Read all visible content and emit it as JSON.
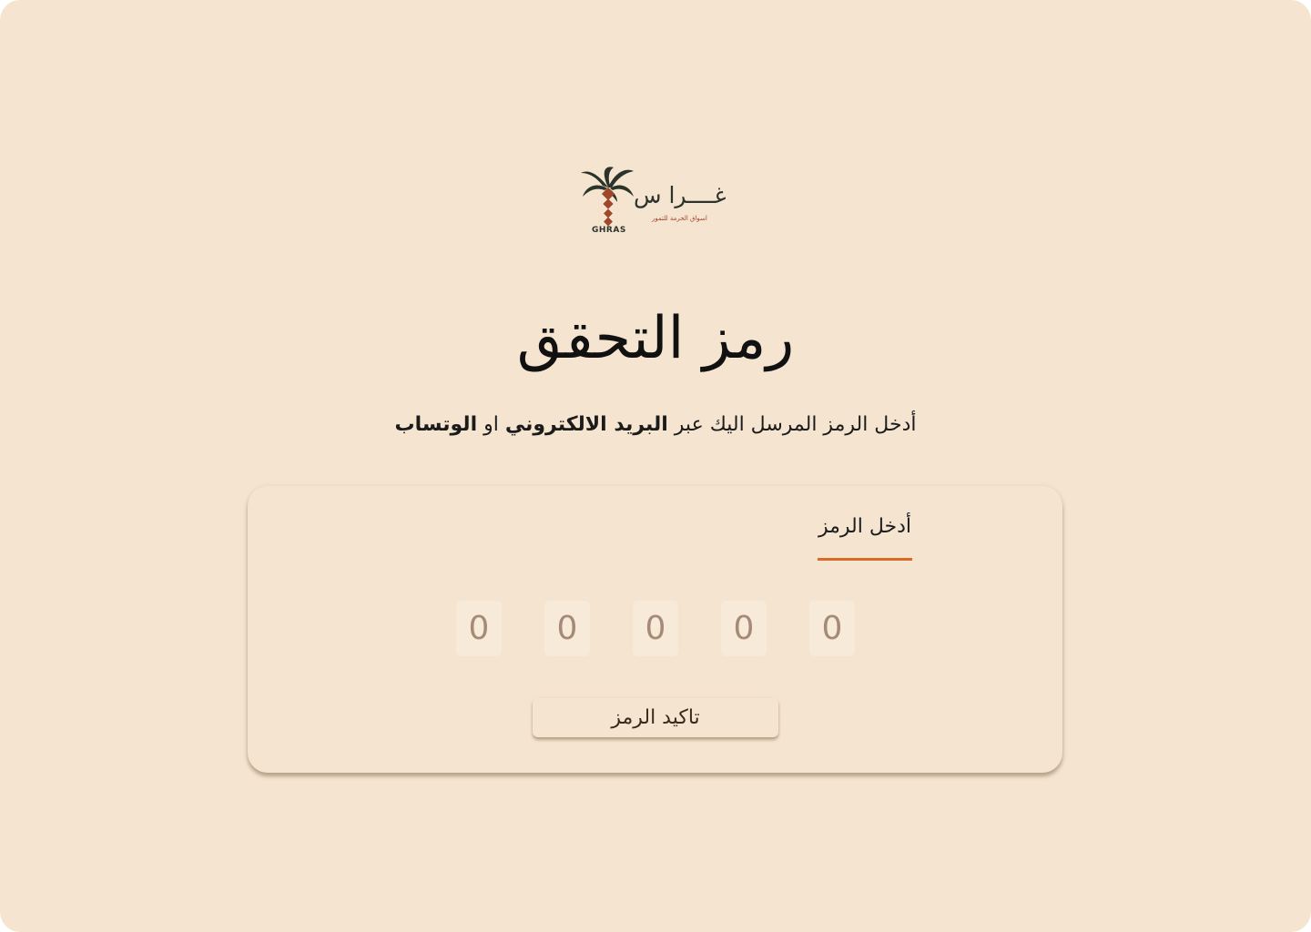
{
  "logo": {
    "arabic_name": "غــــرا س",
    "tagline": "اسواق الخرمة للتمور",
    "english_name": "GHRAS"
  },
  "title": "رمز التحقق",
  "subtitle": {
    "prefix": "أدخل الرمز المرسل اليك عبر ",
    "email": "البريد الالكتروني",
    "connector": " او ",
    "whatsapp": "الوتساب"
  },
  "form": {
    "tab_label": "أدخل الرمز",
    "code_digits": [
      "0",
      "0",
      "0",
      "0",
      "0"
    ],
    "confirm_label": "تاكيد الرمز"
  },
  "colors": {
    "background": "#f5e5d0",
    "accent": "#d86a25",
    "digit_text": "#a58b76",
    "logo_dark": "#2b332a",
    "logo_brown": "#a0462b"
  }
}
